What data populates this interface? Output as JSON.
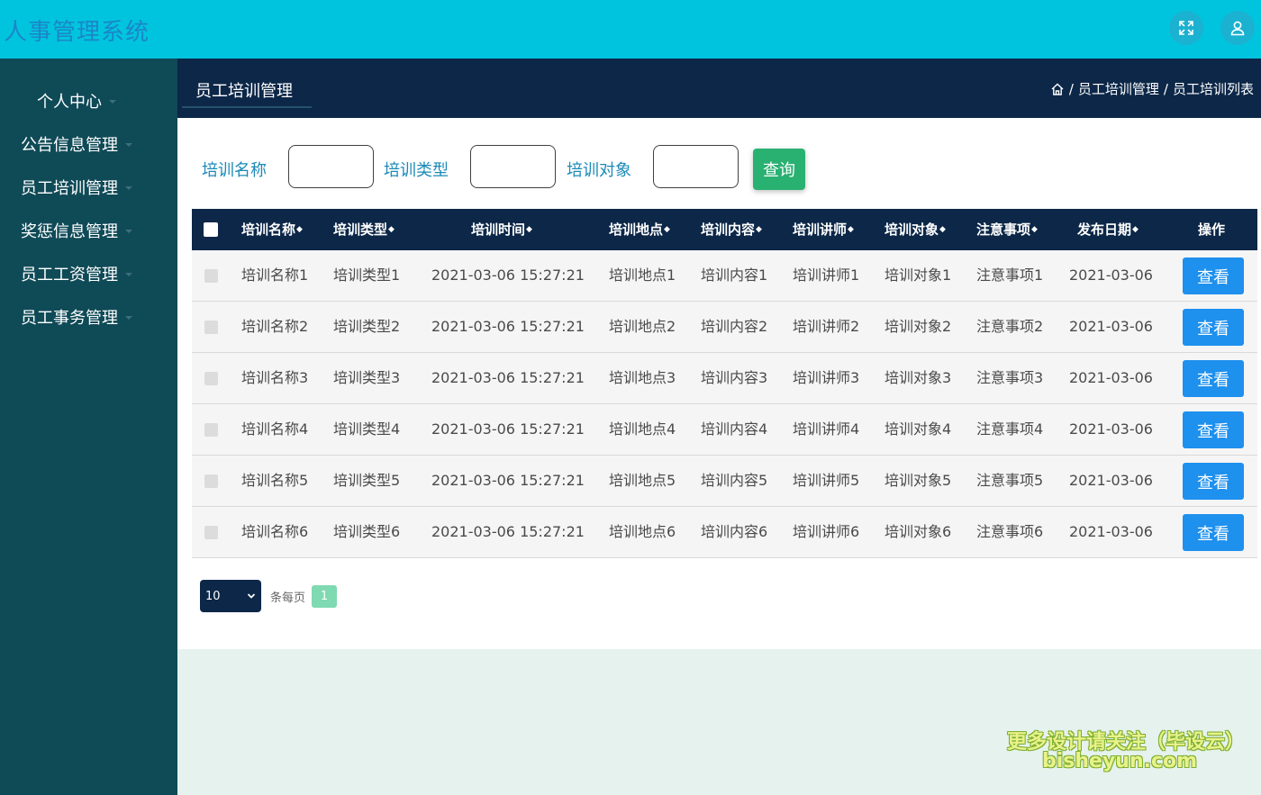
{
  "app": {
    "title": "人事管理系统"
  },
  "sidebar": {
    "items": [
      {
        "label": "个人中心"
      },
      {
        "label": "公告信息管理"
      },
      {
        "label": "员工培训管理"
      },
      {
        "label": "奖惩信息管理"
      },
      {
        "label": "员工工资管理"
      },
      {
        "label": "员工事务管理"
      }
    ]
  },
  "header": {
    "page_title": "员工培训管理",
    "breadcrumb": [
      "员工培训管理",
      "员工培训列表"
    ],
    "separator": "/"
  },
  "search": {
    "fields": [
      {
        "label": "培训名称",
        "value": ""
      },
      {
        "label": "培训类型",
        "value": ""
      },
      {
        "label": "培训对象",
        "value": ""
      }
    ],
    "query_label": "查询"
  },
  "table": {
    "columns": [
      "培训名称",
      "培训类型",
      "培训时间",
      "培训地点",
      "培训内容",
      "培训讲师",
      "培训对象",
      "注意事项",
      "发布日期",
      "操作"
    ],
    "sort_glyph": "◆",
    "rows": [
      {
        "name": "培训名称1",
        "type": "培训类型1",
        "time": "2021-03-06 15:27:21",
        "place": "培训地点1",
        "content": "培训内容1",
        "lecturer": "培训讲师1",
        "target": "培训对象1",
        "notes": "注意事项1",
        "date": "2021-03-06",
        "action": "查看"
      },
      {
        "name": "培训名称2",
        "type": "培训类型2",
        "time": "2021-03-06 15:27:21",
        "place": "培训地点2",
        "content": "培训内容2",
        "lecturer": "培训讲师2",
        "target": "培训对象2",
        "notes": "注意事项2",
        "date": "2021-03-06",
        "action": "查看"
      },
      {
        "name": "培训名称3",
        "type": "培训类型3",
        "time": "2021-03-06 15:27:21",
        "place": "培训地点3",
        "content": "培训内容3",
        "lecturer": "培训讲师3",
        "target": "培训对象3",
        "notes": "注意事项3",
        "date": "2021-03-06",
        "action": "查看"
      },
      {
        "name": "培训名称4",
        "type": "培训类型4",
        "time": "2021-03-06 15:27:21",
        "place": "培训地点4",
        "content": "培训内容4",
        "lecturer": "培训讲师4",
        "target": "培训对象4",
        "notes": "注意事项4",
        "date": "2021-03-06",
        "action": "查看"
      },
      {
        "name": "培训名称5",
        "type": "培训类型5",
        "time": "2021-03-06 15:27:21",
        "place": "培训地点5",
        "content": "培训内容5",
        "lecturer": "培训讲师5",
        "target": "培训对象5",
        "notes": "注意事项5",
        "date": "2021-03-06",
        "action": "查看"
      },
      {
        "name": "培训名称6",
        "type": "培训类型6",
        "time": "2021-03-06 15:27:21",
        "place": "培训地点6",
        "content": "培训内容6",
        "lecturer": "培训讲师6",
        "target": "培训对象6",
        "notes": "注意事项6",
        "date": "2021-03-06",
        "action": "查看"
      }
    ]
  },
  "pagination": {
    "page_size": "10",
    "per_page_label": "条每页",
    "current_page": "1"
  },
  "watermark": {
    "line1": "更多设计请关注（毕设云）",
    "line2": "bisheyun.com"
  },
  "icons": {
    "fullscreen": "fullscreen-icon",
    "user": "user-icon",
    "home": "home-icon",
    "caret": "caret-down-icon",
    "select_chevron": "chevron-down-icon"
  },
  "colors": {
    "topbar": "#00c4de",
    "sidebar": "#0f4a57",
    "header": "#0c2748",
    "query_button": "#29b172",
    "view_button": "#1e90ee",
    "page_active": "#7fd9b1"
  }
}
